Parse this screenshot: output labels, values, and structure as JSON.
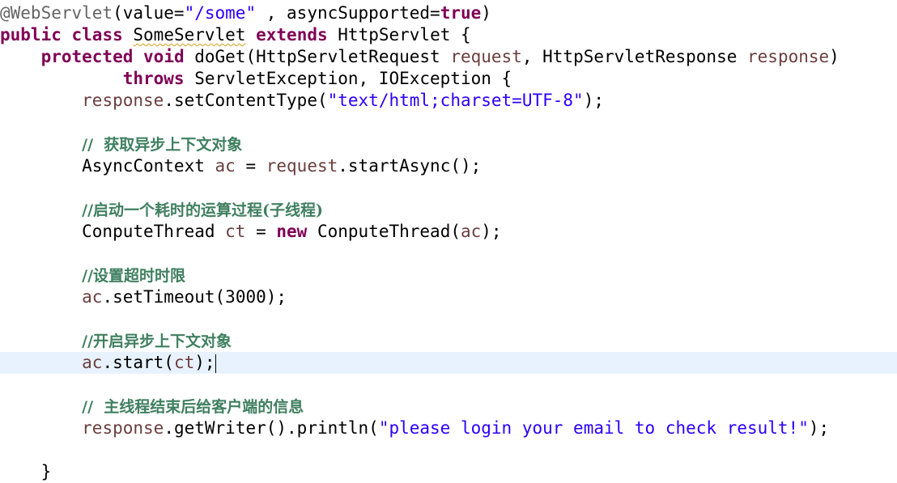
{
  "editor": {
    "current_line_index": 16,
    "lines": [
      [
        {
          "t": "@WebServlet",
          "c": "ann"
        },
        {
          "t": "(value=",
          "c": "plain"
        },
        {
          "t": "\"/some\"",
          "c": "str"
        },
        {
          "t": " , asyncSupported=",
          "c": "plain"
        },
        {
          "t": "true",
          "c": "kw"
        },
        {
          "t": ")",
          "c": "plain"
        }
      ],
      [
        {
          "t": "public",
          "c": "kw"
        },
        {
          "t": " ",
          "c": "plain"
        },
        {
          "t": "class",
          "c": "kw"
        },
        {
          "t": " ",
          "c": "plain"
        },
        {
          "t": "SomeServlet",
          "c": "plain squiggle"
        },
        {
          "t": " ",
          "c": "plain"
        },
        {
          "t": "extends",
          "c": "kw"
        },
        {
          "t": " HttpServlet {",
          "c": "plain"
        }
      ],
      [
        {
          "t": "    ",
          "c": "plain"
        },
        {
          "t": "protected",
          "c": "kw"
        },
        {
          "t": " ",
          "c": "plain"
        },
        {
          "t": "void",
          "c": "kw"
        },
        {
          "t": " doGet(HttpServletRequest ",
          "c": "plain"
        },
        {
          "t": "request",
          "c": "var"
        },
        {
          "t": ", HttpServletResponse ",
          "c": "plain"
        },
        {
          "t": "response",
          "c": "var"
        },
        {
          "t": ")",
          "c": "plain"
        }
      ],
      [
        {
          "t": "            ",
          "c": "plain"
        },
        {
          "t": "throws",
          "c": "kw"
        },
        {
          "t": " ServletException, IOException {",
          "c": "plain"
        }
      ],
      [
        {
          "t": "        ",
          "c": "plain"
        },
        {
          "t": "response",
          "c": "var"
        },
        {
          "t": ".setContentType(",
          "c": "plain"
        },
        {
          "t": "\"text/html;charset=UTF-8\"",
          "c": "str"
        },
        {
          "t": ");",
          "c": "plain"
        }
      ],
      [],
      [
        {
          "t": "        ",
          "c": "plain"
        },
        {
          "t": "//  获取异步上下文对象",
          "c": "cmt"
        }
      ],
      [
        {
          "t": "        AsyncContext ",
          "c": "plain"
        },
        {
          "t": "ac",
          "c": "var"
        },
        {
          "t": " = ",
          "c": "plain"
        },
        {
          "t": "request",
          "c": "var"
        },
        {
          "t": ".startAsync();",
          "c": "plain"
        }
      ],
      [],
      [
        {
          "t": "        ",
          "c": "plain"
        },
        {
          "t": "//启动一个耗时的运算过程(子线程)",
          "c": "cmt"
        }
      ],
      [
        {
          "t": "        ConputeThread ",
          "c": "plain"
        },
        {
          "t": "ct",
          "c": "var"
        },
        {
          "t": " = ",
          "c": "plain"
        },
        {
          "t": "new",
          "c": "kw"
        },
        {
          "t": " ConputeThread(",
          "c": "plain"
        },
        {
          "t": "ac",
          "c": "var"
        },
        {
          "t": ");",
          "c": "plain"
        }
      ],
      [],
      [
        {
          "t": "        ",
          "c": "plain"
        },
        {
          "t": "//设置超时时限",
          "c": "cmt"
        }
      ],
      [
        {
          "t": "        ",
          "c": "plain"
        },
        {
          "t": "ac",
          "c": "var"
        },
        {
          "t": ".setTimeout(3000);",
          "c": "plain"
        }
      ],
      [],
      [
        {
          "t": "        ",
          "c": "plain"
        },
        {
          "t": "//开启异步上下文对象",
          "c": "cmt"
        }
      ],
      [
        {
          "t": "        ",
          "c": "plain"
        },
        {
          "t": "ac",
          "c": "var"
        },
        {
          "t": ".start(",
          "c": "plain"
        },
        {
          "t": "ct",
          "c": "var"
        },
        {
          "t": ");",
          "c": "plain"
        },
        {
          "t": "",
          "c": "caret"
        }
      ],
      [],
      [
        {
          "t": "        ",
          "c": "plain"
        },
        {
          "t": "//  主线程结束后给客户端的信息",
          "c": "cmt"
        }
      ],
      [
        {
          "t": "        ",
          "c": "plain"
        },
        {
          "t": "response",
          "c": "var"
        },
        {
          "t": ".getWriter().println(",
          "c": "plain"
        },
        {
          "t": "\"please login your email to check result!\"",
          "c": "str"
        },
        {
          "t": ");",
          "c": "plain"
        }
      ],
      [],
      [
        {
          "t": "    }",
          "c": "plain"
        }
      ]
    ]
  }
}
